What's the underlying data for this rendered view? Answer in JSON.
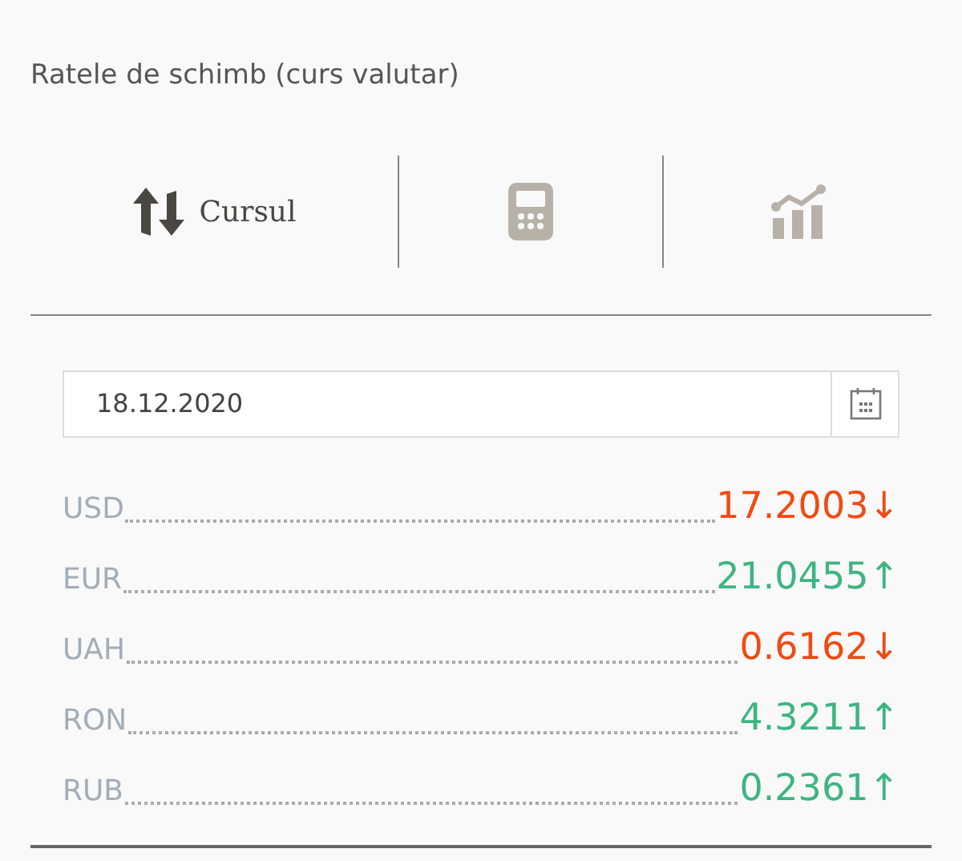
{
  "title": "Ratele de schimb (curs valutar)",
  "tabs": [
    {
      "kind": "exchange",
      "label": "Cursul",
      "selected": true
    },
    {
      "kind": "calculator",
      "selected": false
    },
    {
      "kind": "chart",
      "selected": false
    }
  ],
  "date_field": {
    "value": "18.12.2020"
  },
  "rates": [
    {
      "currency": "USD",
      "value": "17.2003",
      "arrow": "↓",
      "rising": false
    },
    {
      "currency": "EUR",
      "value": "21.0455",
      "arrow": "↑",
      "rising": true
    },
    {
      "currency": "UAH",
      "value": "0.6162",
      "arrow": "↓",
      "rising": false
    },
    {
      "currency": "RON",
      "value": "4.3211",
      "arrow": "↑",
      "rising": true
    },
    {
      "currency": "RUB",
      "value": "0.2361",
      "arrow": "↑",
      "rising": true
    }
  ]
}
